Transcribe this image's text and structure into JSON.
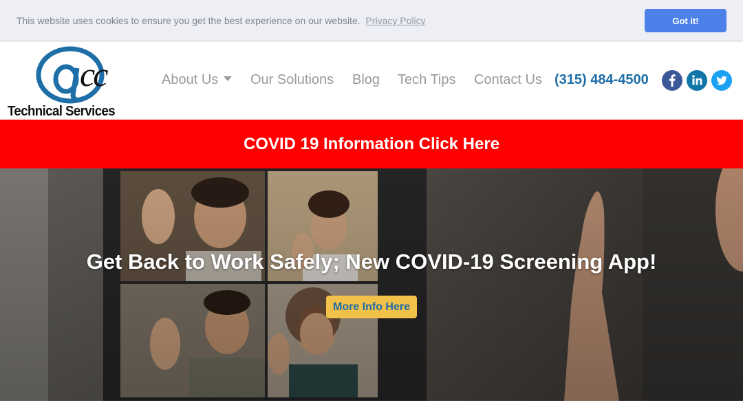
{
  "cookie_banner": {
    "message": "This website uses cookies to ensure you get the best experience on our website.",
    "link_label": "Privacy Policy",
    "button_label": "Got it!",
    "button_color": "#4b81e8"
  },
  "header": {
    "logo": {
      "mark": "@cc",
      "wordmark": "Technical Services"
    },
    "nav": [
      {
        "label": "About Us",
        "has_dropdown": true
      },
      {
        "label": "Our Solutions"
      },
      {
        "label": "Blog"
      },
      {
        "label": "Tech Tips"
      },
      {
        "label": "Contact Us"
      }
    ],
    "phone": "(315) 484-4500",
    "social": [
      {
        "icon": "facebook-icon",
        "color": "#3b5998"
      },
      {
        "icon": "linkedin-icon",
        "color": "#0e76a8"
      },
      {
        "icon": "twitter-icon",
        "color": "#1da1f2"
      }
    ]
  },
  "covid_banner": {
    "label": "COVID 19 Information Click Here",
    "color": "#ff0000"
  },
  "hero": {
    "title": "Get Back to Work Safely; New COVID-19 Screening App!",
    "button_label": "More Info Here"
  }
}
